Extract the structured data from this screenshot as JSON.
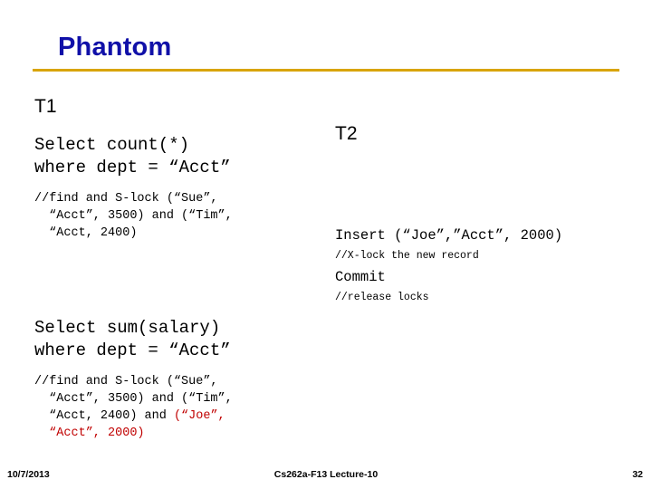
{
  "slide": {
    "title": "Phantom",
    "accent_color": "#d9a40a",
    "title_color": "#1010a8",
    "comment_color": "#c00000"
  },
  "transactions": {
    "t1": {
      "label": "T1",
      "select_count": "Select count(*)\nwhere dept = “Acct”",
      "comment_1": "//find and S-lock (“Sue”,\n  “Acct”, 3500) and (“Tim”,\n  “Acct, 2400)",
      "select_sum": "Select sum(salary)\nwhere dept = “Acct”",
      "comment_2_part1": "//find and S-lock (“Sue”,\n  “Acct”, 3500) and (“Tim”,\n  “Acct, 2400) and ",
      "comment_2_part2": "(“Joe”,\n  “Acct”, 2000)"
    },
    "t2": {
      "label": "T2",
      "insert": "Insert (“Joe”,”Acct”, 2000)",
      "xlock_comment": "//X-lock the new record",
      "commit": "Commit",
      "release_comment": "//release locks"
    }
  },
  "footer": {
    "date": "10/7/2013",
    "center": "Cs262a-F13 Lecture-10",
    "page": "32"
  }
}
